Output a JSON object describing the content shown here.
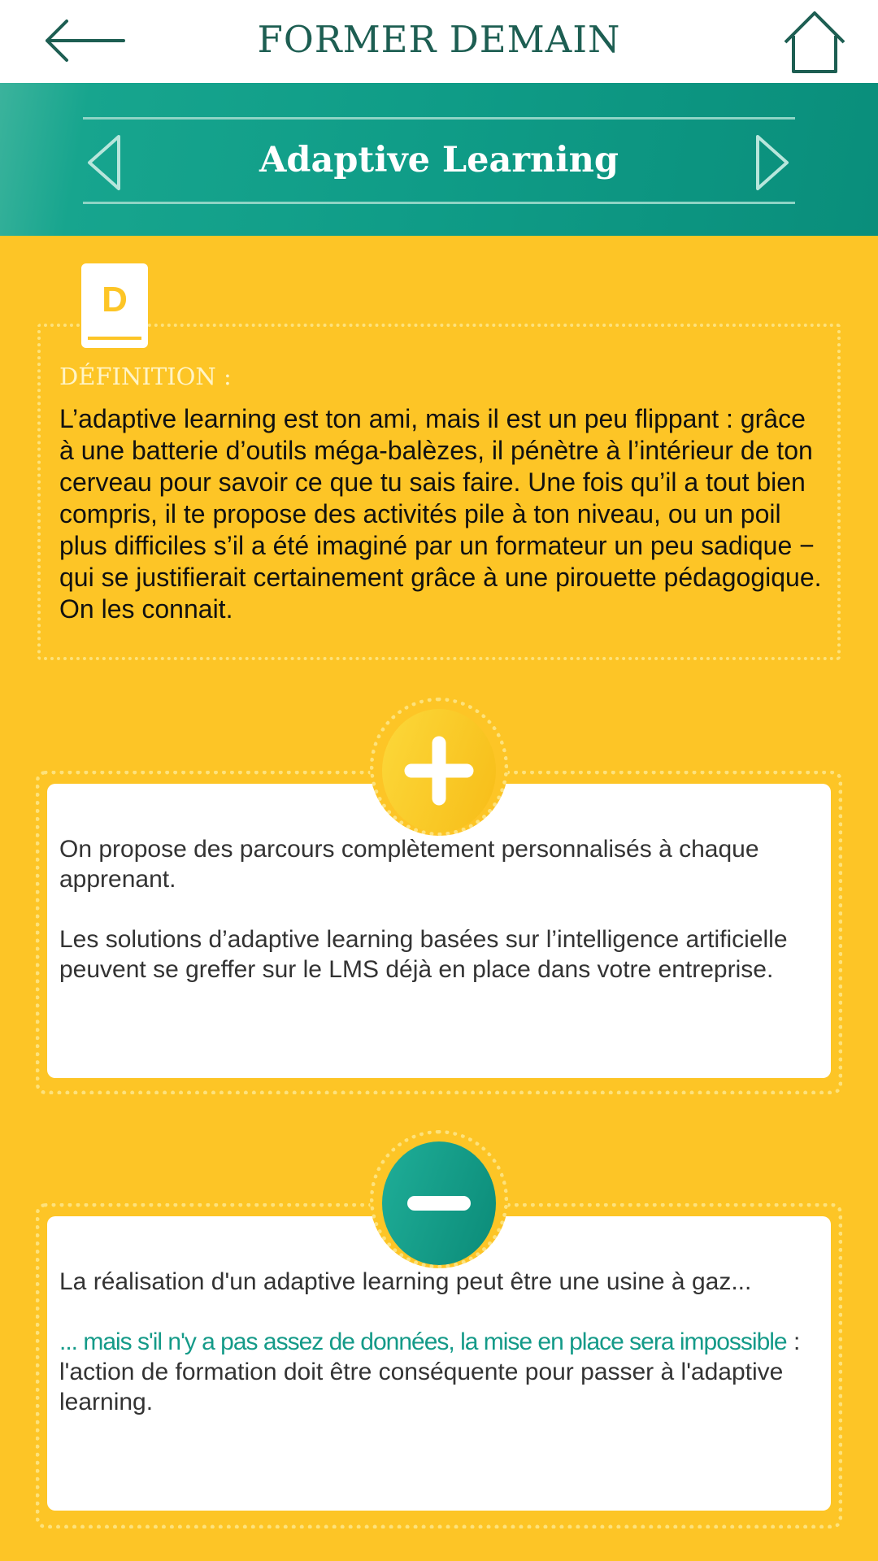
{
  "header": {
    "title": "FORMER DEMAIN",
    "back_icon": "arrow-left-icon",
    "home_icon": "home-icon"
  },
  "banner": {
    "title": "Adaptive Learning",
    "prev_icon": "triangle-left-icon",
    "next_icon": "triangle-right-icon"
  },
  "definition": {
    "icon_letter": "D",
    "label": "DÉFINITION :",
    "text": "L’adaptive learning est ton ami, mais il est un peu flippant : grâce à une batterie d’outils méga-balèzes, il pénètre à l’intérieur de ton cerveau pour savoir ce que tu sais faire. Une fois qu’il a tout bien compris, il te propose des activités pile à ton niveau, ou un poil plus difficiles s’il a été imaginé par un formateur un peu sadique − qui se justifierait certainement grâce à une pirouette pédagogique. On les connait."
  },
  "pros": {
    "icon": "plus-icon",
    "paragraphs": [
      "On propose des parcours complètement personnalisés à chaque apprenant.",
      "Les solutions d’adaptive learning basées sur l’intelligence artificielle peuvent se greffer sur le LMS déjà en place dans votre entreprise."
    ]
  },
  "cons": {
    "icon": "minus-icon",
    "paragraph_1": "La réalisation d'un adaptive learning peut être une usine à gaz...",
    "highlight": "... mais s'il n'y a pas assez de données, la mise en place sera impossible",
    "paragraph_2_rest": " :  l'action de formation doit être conséquente pour passer à l'adaptive learning."
  },
  "colors": {
    "background": "#fdc526",
    "teal": "#0f9c87",
    "title_green": "#1d5e52",
    "highlight_green": "#149a88"
  }
}
